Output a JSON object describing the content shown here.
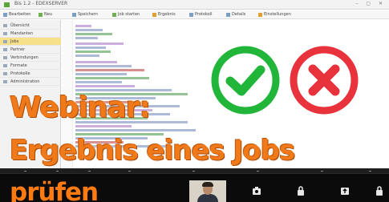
{
  "app": {
    "title": "Bis 1.2 - EDEXSERVER",
    "window_controls": "– ▢ ✕",
    "toolbar": [
      {
        "label": "Bearbeiten"
      },
      {
        "label": "Neu"
      },
      {
        "label": "Speichern"
      },
      {
        "label": "Job starten"
      },
      {
        "label": "Ergebnis"
      },
      {
        "label": "Protokoll"
      },
      {
        "label": "Details"
      },
      {
        "label": "Einstellungen"
      }
    ],
    "sidebar": [
      {
        "label": "Übersicht",
        "active": false
      },
      {
        "label": "Mandanten",
        "active": false
      },
      {
        "label": "Jobs",
        "active": true
      },
      {
        "label": "Partner",
        "active": false
      },
      {
        "label": "Verbindungen",
        "active": false
      },
      {
        "label": "Formate",
        "active": false
      },
      {
        "label": "Protokolle",
        "active": false
      },
      {
        "label": "Administration",
        "active": false
      }
    ]
  },
  "icons": {
    "success": "check-circle-icon",
    "failure": "close-circle-icon",
    "success_color": "#21b53a",
    "failure_color": "#e8323c"
  },
  "overlay": {
    "line1": "Webinar:",
    "line2": "Ergebnis eines Jobs",
    "line3": "prüfen",
    "color": "#f07a1a"
  },
  "meeting": {
    "controls": [
      "camera-icon",
      "lock-icon",
      "share-icon",
      "lock-icon"
    ]
  }
}
